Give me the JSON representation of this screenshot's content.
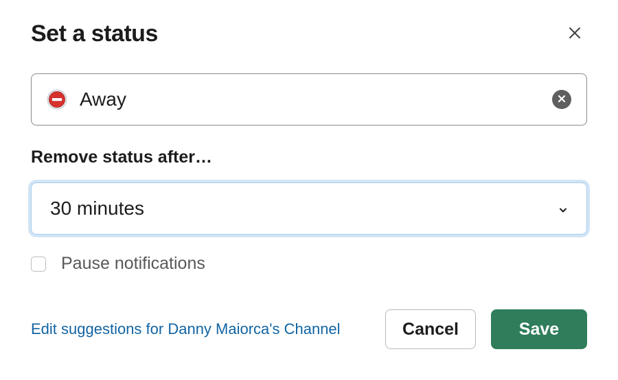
{
  "modal": {
    "title": "Set a status"
  },
  "status": {
    "text": "Away",
    "emoji_name": "no-entry"
  },
  "duration": {
    "label": "Remove status after…",
    "selected": "30 minutes"
  },
  "pause": {
    "label": "Pause notifications",
    "checked": false
  },
  "footer": {
    "link_text": "Edit suggestions for Danny Maiorca's Channel",
    "cancel_label": "Cancel",
    "save_label": "Save"
  },
  "colors": {
    "accent": "#2f7d5a",
    "link": "#1264a3",
    "focus_ring": "#d1e5f6"
  }
}
